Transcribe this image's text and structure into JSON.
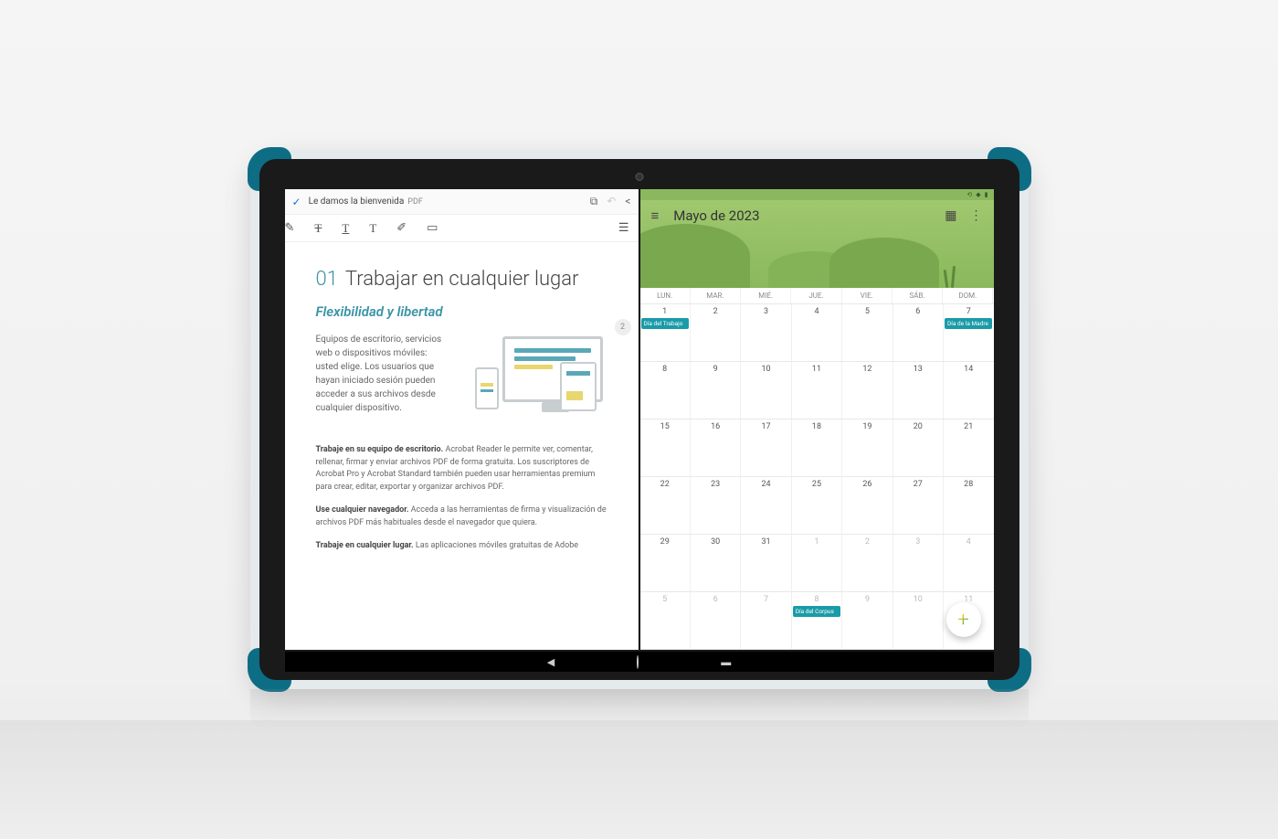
{
  "pdf": {
    "header_title": "Le damos la bienvenida",
    "header_format": "PDF",
    "page_badge": "2",
    "doc_number": "01",
    "doc_title": "Trabajar en cualquier lugar",
    "subtitle": "Flexibilidad y libertad",
    "intro": "Equipos de escritorio, servicios web o dispositivos móviles: usted elige. Los usuarios que hayan iniciado sesión pueden acceder a sus archivos desde cualquier dispositivo.",
    "para1_bold": "Trabaje en su equipo de escritorio.",
    "para1_rest": " Acrobat Reader le permite ver, comentar, rellenar, firmar y enviar archivos PDF de forma gratuita. Los suscriptores de Acrobat Pro y Acrobat Standard también pueden usar herramientas premium para crear, editar, exportar y organizar archivos PDF.",
    "para2_bold": "Use cualquier navegador.",
    "para2_rest": " Acceda a las herramientas de firma y visualización de archivos PDF más habituales desde el navegador que quiera.",
    "para3_bold": "Trabaje en cualquier lugar.",
    "para3_rest": " Las aplicaciones móviles gratuitas de Adobe"
  },
  "calendar": {
    "title": "Mayo de 2023",
    "days": [
      "LUN.",
      "MAR.",
      "MIÉ.",
      "JUE.",
      "VIE.",
      "SÁB.",
      "DOM."
    ],
    "weeks": [
      [
        {
          "d": "1",
          "ev": "Día del Trabajo"
        },
        {
          "d": "2"
        },
        {
          "d": "3"
        },
        {
          "d": "4"
        },
        {
          "d": "5"
        },
        {
          "d": "6"
        },
        {
          "d": "7",
          "ev": "Día de la Madre"
        }
      ],
      [
        {
          "d": "8"
        },
        {
          "d": "9"
        },
        {
          "d": "10"
        },
        {
          "d": "11"
        },
        {
          "d": "12"
        },
        {
          "d": "13"
        },
        {
          "d": "14"
        }
      ],
      [
        {
          "d": "15"
        },
        {
          "d": "16"
        },
        {
          "d": "17"
        },
        {
          "d": "18"
        },
        {
          "d": "19"
        },
        {
          "d": "20"
        },
        {
          "d": "21"
        }
      ],
      [
        {
          "d": "22"
        },
        {
          "d": "23"
        },
        {
          "d": "24"
        },
        {
          "d": "25"
        },
        {
          "d": "26"
        },
        {
          "d": "27"
        },
        {
          "d": "28"
        }
      ],
      [
        {
          "d": "29"
        },
        {
          "d": "30"
        },
        {
          "d": "31"
        },
        {
          "d": "1",
          "other": true
        },
        {
          "d": "2",
          "other": true
        },
        {
          "d": "3",
          "other": true
        },
        {
          "d": "4",
          "other": true
        }
      ],
      [
        {
          "d": "5",
          "other": true
        },
        {
          "d": "6",
          "other": true
        },
        {
          "d": "7",
          "other": true
        },
        {
          "d": "8",
          "other": true,
          "ev": "Día del Corpus"
        },
        {
          "d": "9",
          "other": true
        },
        {
          "d": "10",
          "other": true
        },
        {
          "d": "11",
          "other": true
        }
      ]
    ]
  }
}
